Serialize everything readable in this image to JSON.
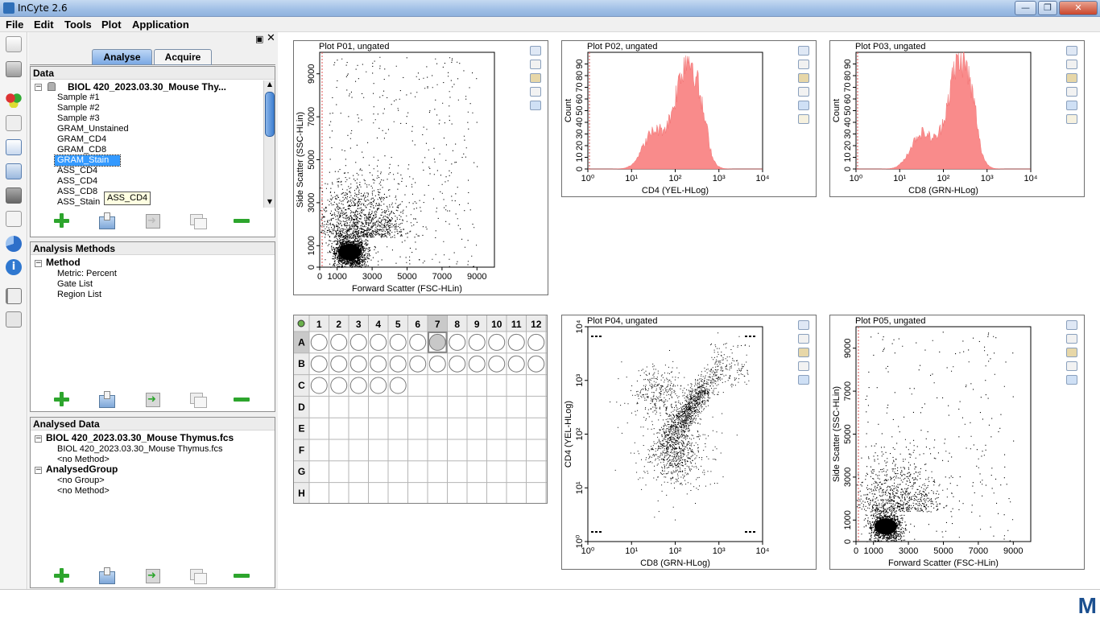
{
  "window": {
    "title": "InCyte 2.6"
  },
  "menu": [
    "File",
    "Edit",
    "Tools",
    "Plot",
    "Application"
  ],
  "tabs": {
    "analyse": "Analyse",
    "acquire": "Acquire"
  },
  "data_panel": {
    "header": "Data",
    "root": "BIOL 420_2023.03.30_Mouse Thy...",
    "items": [
      "Sample #1",
      "Sample #2",
      "Sample #3",
      "GRAM_Unstained",
      "GRAM_CD4",
      "GRAM_CD8",
      "GRAM_Stain",
      "ASS_CD4",
      "ASS_CD4",
      "ASS_CD8",
      "ASS_Stain"
    ],
    "selected_index": 6,
    "tooltip": "ASS_CD4"
  },
  "methods_panel": {
    "header": "Analysis Methods",
    "root": "Method",
    "items": [
      "Metric: Percent",
      "Gate List",
      "Region List"
    ]
  },
  "analysed_panel": {
    "header": "Analysed Data",
    "root1": "BIOL 420_2023.03.30_Mouse Thymus.fcs",
    "root1_items": [
      "BIOL 420_2023.03.30_Mouse Thymus.fcs",
      "<no Method>"
    ],
    "root2": "AnalysedGroup",
    "root2_items": [
      "<no Group>",
      "<no Method>"
    ]
  },
  "plots": [
    {
      "title": "Plot P01, ungated",
      "xlabel": "Forward Scatter (FSC-HLin)",
      "ylabel": "Side Scatter (SSC-HLin)",
      "type": "scatter-lin",
      "xticks": [
        "0",
        "1000",
        "3000",
        "5000",
        "7000",
        "9000"
      ],
      "yticks": [
        "0",
        "1000",
        "3000",
        "5000",
        "7000",
        "9000"
      ]
    },
    {
      "title": "Plot P02, ungated",
      "xlabel": "CD4 (YEL-HLog)",
      "ylabel": "Count",
      "type": "histogram",
      "xticks": [
        "10⁰",
        "10¹",
        "10²",
        "10³",
        "10⁴"
      ],
      "yticks": [
        "0",
        "10",
        "20",
        "30",
        "40",
        "50",
        "60",
        "70",
        "80",
        "90"
      ]
    },
    {
      "title": "Plot P03, ungated",
      "xlabel": "CD8 (GRN-HLog)",
      "ylabel": "Count",
      "type": "histogram",
      "xticks": [
        "10⁰",
        "10¹",
        "10²",
        "10³",
        "10⁴"
      ],
      "yticks": [
        "0",
        "10",
        "20",
        "30",
        "40",
        "50",
        "60",
        "70",
        "80",
        "90"
      ]
    },
    {
      "title": "Plot P04, ungated",
      "xlabel": "CD8 (GRN-HLog)",
      "ylabel": "CD4 (YEL-HLog)",
      "type": "scatter-log",
      "xticks": [
        "10⁰",
        "10¹",
        "10²",
        "10³",
        "10⁴"
      ],
      "yticks": [
        "10⁰",
        "10¹",
        "10²",
        "10³",
        "10⁴"
      ]
    },
    {
      "title": "Plot P05, ungated",
      "xlabel": "Forward Scatter (FSC-HLin)",
      "ylabel": "Side Scatter (SSC-HLin)",
      "type": "scatter-lin",
      "xticks": [
        "0",
        "1000",
        "3000",
        "5000",
        "7000",
        "9000"
      ],
      "yticks": [
        "0",
        "1000",
        "3000",
        "5000",
        "7000",
        "9000"
      ]
    }
  ],
  "wellplate": {
    "columns": [
      "1",
      "2",
      "3",
      "4",
      "5",
      "6",
      "7",
      "8",
      "9",
      "10",
      "11",
      "12"
    ],
    "rows": [
      "A",
      "B",
      "C",
      "D",
      "E",
      "F",
      "G",
      "H"
    ],
    "filled_counts": [
      12,
      12,
      5,
      0,
      0,
      0,
      0,
      0
    ],
    "selected": "A7"
  },
  "colors": {
    "histogram_fill": "#f98b8b",
    "selection": "#3399ff",
    "gate_line": "#e05050"
  },
  "chart_data": [
    {
      "type": "scatter",
      "title": "Plot P01, ungated",
      "xlabel": "Forward Scatter (FSC-HLin)",
      "ylabel": "Side Scatter (SSC-HLin)",
      "xlim": [
        0,
        10000
      ],
      "ylim": [
        0,
        10000
      ],
      "note": "dense cluster near x≈1700, y≈800"
    },
    {
      "type": "area",
      "title": "Plot P02, ungated",
      "xlabel": "CD4 (YEL-HLog)",
      "ylabel": "Count",
      "xscale": "log",
      "xlim": [
        1,
        10000
      ],
      "ylim": [
        0,
        100
      ],
      "peak_x": 200
    },
    {
      "type": "area",
      "title": "Plot P03, ungated",
      "xlabel": "CD8 (GRN-HLog)",
      "ylabel": "Count",
      "xscale": "log",
      "xlim": [
        1,
        10000
      ],
      "ylim": [
        0,
        100
      ],
      "peak_x": 250
    },
    {
      "type": "scatter",
      "title": "Plot P04, ungated",
      "xlabel": "CD8 (GRN-HLog)",
      "ylabel": "CD4 (YEL-HLog)",
      "xscale": "log",
      "yscale": "log",
      "xlim": [
        1,
        10000
      ],
      "ylim": [
        1,
        10000
      ]
    },
    {
      "type": "scatter",
      "title": "Plot P05, ungated",
      "xlabel": "Forward Scatter (FSC-HLin)",
      "ylabel": "Side Scatter (SSC-HLin)",
      "xlim": [
        0,
        10000
      ],
      "ylim": [
        0,
        10000
      ]
    }
  ]
}
